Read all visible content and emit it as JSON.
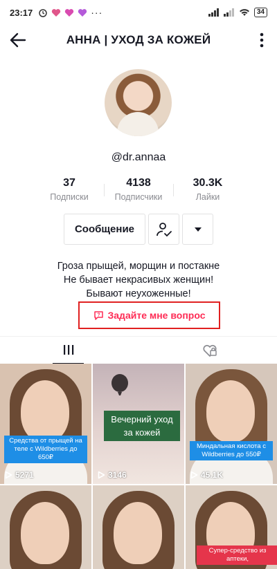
{
  "status": {
    "time": "23:17",
    "battery": "34"
  },
  "header": {
    "title": "АННА | УХОД ЗА КОЖЕЙ"
  },
  "profile": {
    "handle": "@dr.annaa",
    "stats": [
      {
        "value": "37",
        "label": "Подписки"
      },
      {
        "value": "4138",
        "label": "Подписчики"
      },
      {
        "value": "30.3K",
        "label": "Лайки"
      }
    ],
    "message_label": "Сообщение",
    "bio": [
      "Гроза прыщей, морщин и постакне",
      "Не бывает некрасивых женщин!",
      "Бывают неухоженные!"
    ],
    "ask_label": "Задайте мне вопрос"
  },
  "videos": [
    {
      "caption": "Средства от прыщей на теле с Wildberries до 650₽",
      "plays": "5271"
    },
    {
      "caption": "Вечерний уход за кожей",
      "plays": "3146"
    },
    {
      "caption": "Миндальная кислота с Wildberries до 550₽",
      "plays": "45.1K"
    },
    {
      "caption": "",
      "plays": ""
    },
    {
      "caption": "",
      "plays": ""
    },
    {
      "caption": "Супер-средство из аптеки,",
      "plays": ""
    }
  ],
  "colors": {
    "accent": "#fe2c55",
    "highlight": "#e02020",
    "caption_blue": "#1e8ee6",
    "caption_green": "#2b6b3f"
  }
}
